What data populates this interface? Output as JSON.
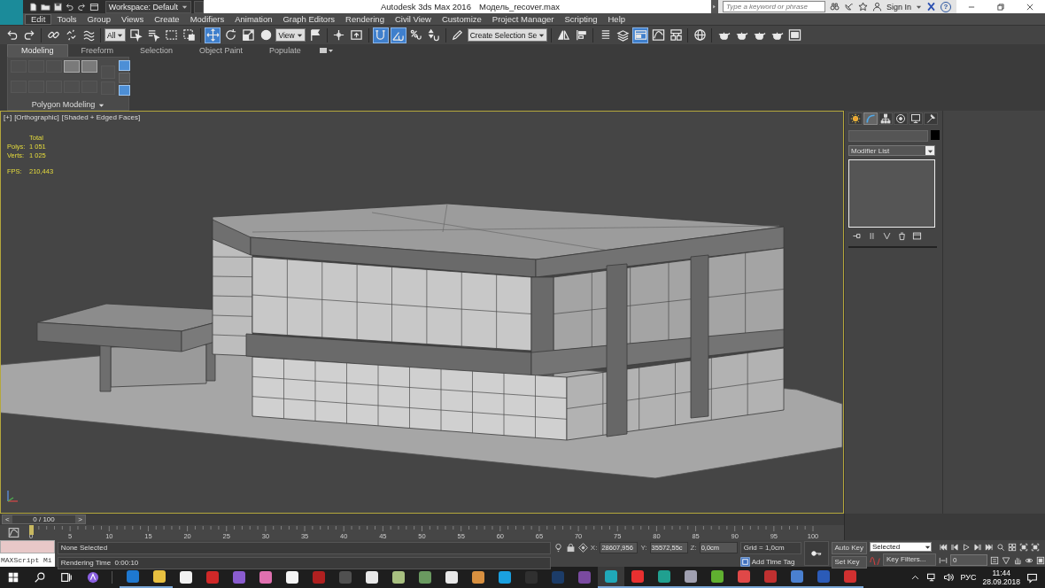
{
  "title_bar": {
    "workspace": "Workspace: Default",
    "app": "Autodesk 3ds Max 2016",
    "file": "Модель_recover.max",
    "search": {
      "placeholder": "Type a keyword or phrase"
    },
    "sign_in": "Sign In",
    "help": "?"
  },
  "menu": [
    {
      "label": "Edit",
      "selected": true
    },
    {
      "label": "Tools",
      "selected": false
    },
    {
      "label": "Group",
      "selected": false
    },
    {
      "label": "Views",
      "selected": false
    },
    {
      "label": "Create",
      "selected": false
    },
    {
      "label": "Modifiers",
      "selected": false
    },
    {
      "label": "Animation",
      "selected": false
    },
    {
      "label": "Graph Editors",
      "selected": false
    },
    {
      "label": "Rendering",
      "selected": false
    },
    {
      "label": "Civil View",
      "selected": false
    },
    {
      "label": "Customize",
      "selected": false
    },
    {
      "label": "Project Manager",
      "selected": false
    },
    {
      "label": "Scripting",
      "selected": false
    },
    {
      "label": "Help",
      "selected": false
    }
  ],
  "toolbar": [
    [
      {
        "kind": "button",
        "selected": false
      },
      {
        "kind": "button",
        "selected": false
      }
    ],
    [
      {
        "kind": "button",
        "selected": false
      },
      {
        "kind": "button",
        "selected": false
      },
      {
        "kind": "button",
        "selected": false
      }
    ],
    [
      {
        "kind": "dropdown",
        "value": "All"
      },
      {
        "kind": "button",
        "selected": false
      },
      {
        "kind": "button",
        "selected": false
      },
      {
        "kind": "button",
        "selected": false
      },
      {
        "kind": "button",
        "selected": false
      }
    ],
    [
      {
        "kind": "button",
        "selected": true
      },
      {
        "kind": "button",
        "selected": false
      },
      {
        "kind": "button",
        "selected": false
      },
      {
        "kind": "button",
        "selected": false
      },
      {
        "kind": "dropdown",
        "value": "View"
      },
      {
        "kind": "button",
        "selected": false
      }
    ],
    [
      {
        "kind": "button",
        "selected": false
      },
      {
        "kind": "button",
        "selected": false
      }
    ],
    [
      {
        "kind": "button",
        "selected": true
      },
      {
        "kind": "button",
        "selected": true
      },
      {
        "kind": "button",
        "selected": false
      },
      {
        "kind": "button",
        "selected": false
      }
    ],
    [
      {
        "kind": "button",
        "selected": false
      },
      {
        "kind": "dropdown",
        "value": "Create Selection Se"
      }
    ],
    [
      {
        "kind": "button",
        "selected": false
      },
      {
        "kind": "button",
        "selected": false
      }
    ],
    [
      {
        "kind": "button",
        "selected": false
      },
      {
        "kind": "button",
        "selected": false
      },
      {
        "kind": "button",
        "selected": true
      },
      {
        "kind": "button",
        "selected": false
      },
      {
        "kind": "button",
        "selected": false
      }
    ],
    [
      {
        "kind": "button",
        "selected": false
      }
    ],
    [
      {
        "kind": "button",
        "selected": false
      },
      {
        "kind": "button",
        "selected": false
      },
      {
        "kind": "button",
        "selected": false
      },
      {
        "kind": "button",
        "selected": false
      },
      {
        "kind": "button",
        "selected": false
      }
    ]
  ],
  "ribbon": {
    "tabs": [
      {
        "label": "Modeling",
        "selected": true
      },
      {
        "label": "Freeform",
        "selected": false
      },
      {
        "label": "Selection",
        "selected": false
      },
      {
        "label": "Object Paint",
        "selected": false
      },
      {
        "label": "Populate",
        "selected": false
      }
    ],
    "panel": {
      "label": "Polygon Modeling",
      "buttons": [
        {
          "disabled": true
        },
        {
          "disabled": true
        },
        {
          "disabled": true
        },
        {
          "disabled": false
        },
        {
          "disabled": false
        },
        {
          "disabled": true
        },
        {
          "disabled": true
        },
        {
          "disabled": true
        },
        {
          "disabled": true
        },
        {
          "disabled": true
        }
      ],
      "side_buttons": [
        {
          "disabled": true
        },
        {
          "disabled": true
        }
      ],
      "toggles": [
        {
          "selected": true
        },
        {
          "selected": false
        },
        {
          "selected": true
        }
      ]
    }
  },
  "viewport": {
    "active": true,
    "labels": [
      "[+]",
      "[Orthographic]",
      "[Shaded + Edged Faces]"
    ],
    "stats": {
      "header": "Total",
      "rows": [
        {
          "label": "Polys:",
          "value": "1 051"
        },
        {
          "label": "Verts:",
          "value": "1 025"
        }
      ],
      "fps_label": "FPS:",
      "fps": "210,443"
    }
  },
  "command_panel": {
    "tabs": [
      {
        "selected": false
      },
      {
        "selected": true
      },
      {
        "selected": false
      },
      {
        "selected": false
      },
      {
        "selected": false
      },
      {
        "selected": false
      }
    ],
    "modifier_list": "Modifier List"
  },
  "time_slider": {
    "prev": "<",
    "position": "0 / 100",
    "next": ">",
    "level": 0
  },
  "track_bar": {
    "labels": [
      "0",
      "5",
      "10",
      "15",
      "20",
      "25",
      "30",
      "35",
      "40",
      "45",
      "50",
      "55",
      "60",
      "65",
      "70",
      "75",
      "80",
      "85",
      "90",
      "95",
      "100"
    ]
  },
  "status": {
    "maxscript": "MAXScript Mi",
    "prompt_lines": [
      "None Selected",
      "Rendering Time  0:00:10"
    ],
    "coords": [
      {
        "axis": "X:",
        "value": "28607,956"
      },
      {
        "axis": "Y:",
        "value": "35572,55c"
      },
      {
        "axis": "Z:",
        "value": "0,0cm"
      }
    ],
    "grid": "Grid = 1,0cm",
    "add_time_tag": "Add Time Tag",
    "auto_key": "Auto Key",
    "set_key": "Set Key",
    "key_mode": "Selected",
    "key_filters": "Key Filters...",
    "frame": "0"
  },
  "taskbar": {
    "apps": [
      {
        "open": true,
        "selected": false
      },
      {
        "open": true,
        "selected": false
      },
      {
        "open": false,
        "selected": false
      },
      {
        "open": false,
        "selected": false
      },
      {
        "open": false,
        "selected": false
      },
      {
        "open": false,
        "selected": false
      },
      {
        "open": false,
        "selected": false
      },
      {
        "open": false,
        "selected": false
      },
      {
        "open": false,
        "selected": false
      },
      {
        "open": false,
        "selected": false
      },
      {
        "open": false,
        "selected": false
      },
      {
        "open": false,
        "selected": false
      },
      {
        "open": false,
        "selected": false
      },
      {
        "open": false,
        "selected": false
      },
      {
        "open": false,
        "selected": false
      },
      {
        "open": false,
        "selected": false
      },
      {
        "open": false,
        "selected": false
      },
      {
        "open": false,
        "selected": false
      },
      {
        "open": true,
        "selected": true
      },
      {
        "open": true,
        "selected": false
      },
      {
        "open": true,
        "selected": false
      },
      {
        "open": true,
        "selected": false
      },
      {
        "open": true,
        "selected": false
      },
      {
        "open": true,
        "selected": false
      },
      {
        "open": true,
        "selected": false
      },
      {
        "open": true,
        "selected": false
      },
      {
        "open": true,
        "selected": false
      },
      {
        "open": true,
        "selected": false
      }
    ],
    "language": "РУС",
    "time": "11:44",
    "date": "28.09.2018"
  }
}
